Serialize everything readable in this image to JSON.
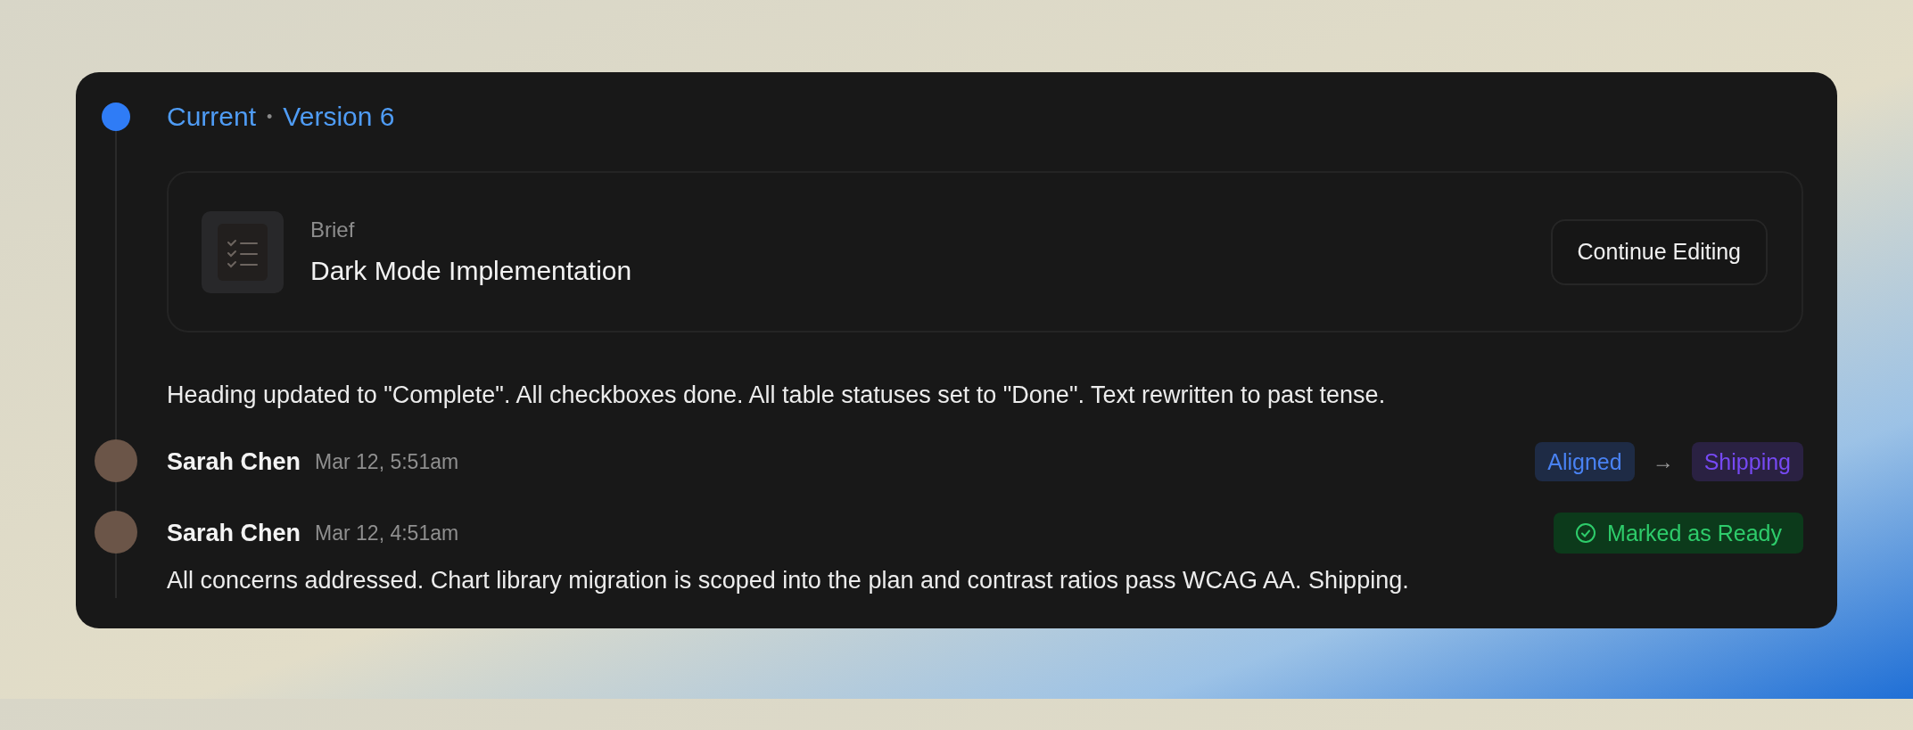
{
  "header": {
    "label": "Current",
    "separator": "•",
    "version": "Version 6"
  },
  "brief": {
    "type_label": "Brief",
    "title": "Dark Mode Implementation",
    "button": "Continue Editing"
  },
  "description": "Heading updated to \"Complete\". All checkboxes done. All table statuses set to \"Done\". Text rewritten to past tense.",
  "events": [
    {
      "kind": "status_change",
      "author": "Sarah Chen",
      "time": "Mar 12, 5:51am",
      "from": {
        "label": "Aligned",
        "color": "#1e2b45"
      },
      "arrow": "→",
      "to": {
        "label": "Shipping",
        "color": "#2a2142"
      }
    },
    {
      "kind": "ready",
      "author": "Sarah Chen",
      "time": "Mar 12, 4:51am",
      "badge": "Marked as Ready",
      "message": "All concerns addressed. Chart library migration is scoped into the plan and contrast ratios pass WCAG AA. Shipping."
    }
  ]
}
